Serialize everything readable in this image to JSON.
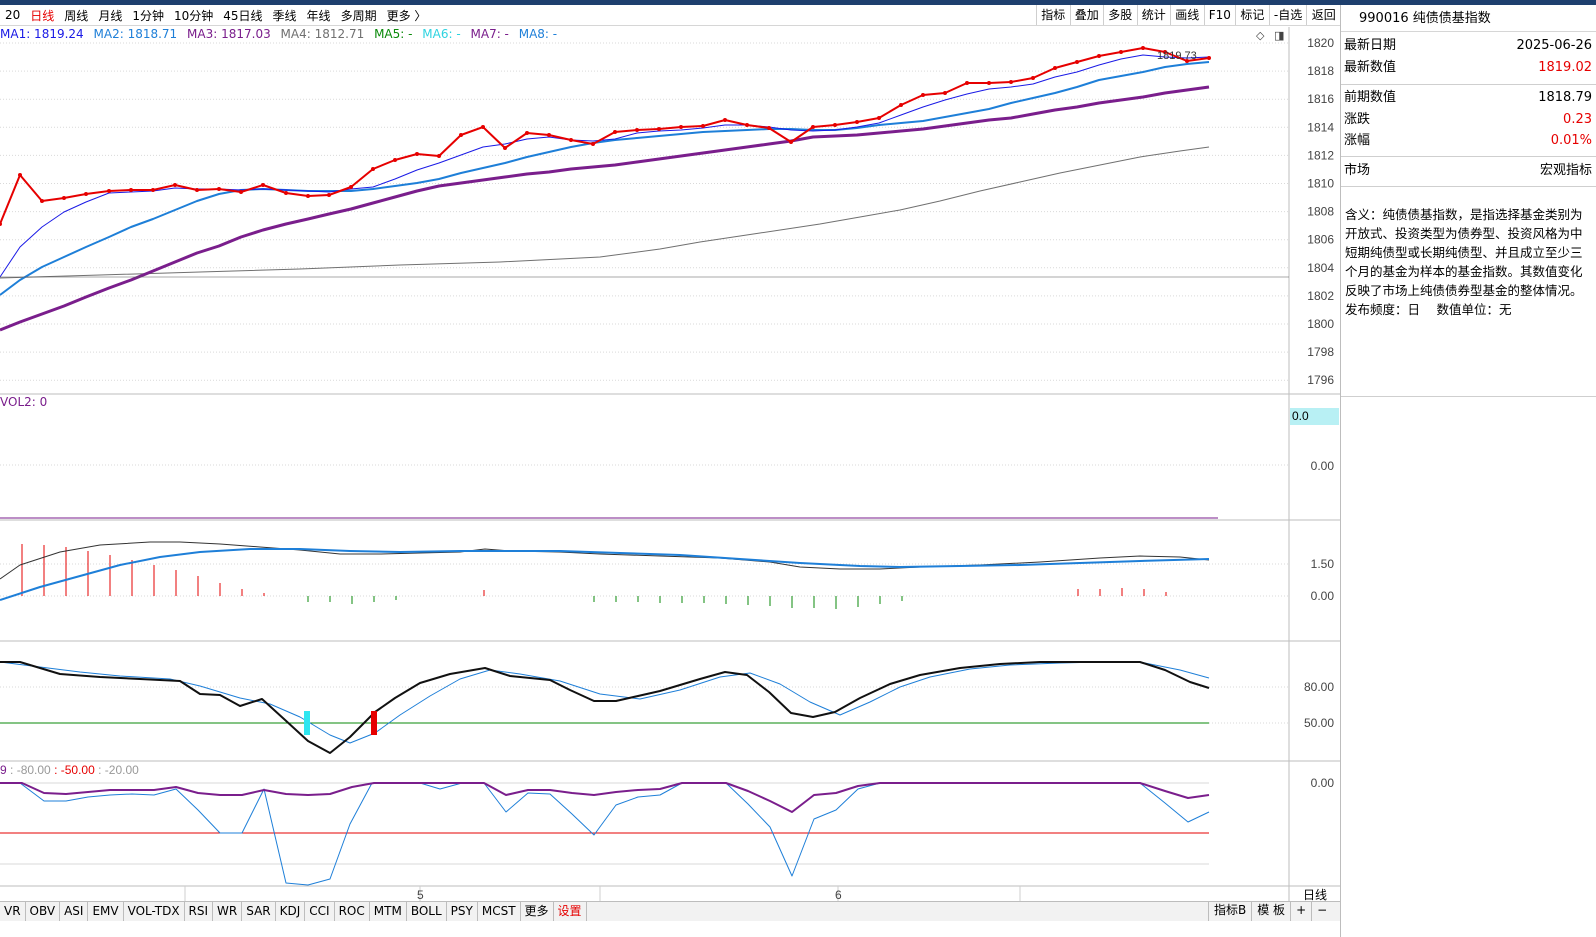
{
  "period_bar": {
    "items": [
      "20",
      "日线",
      "周线",
      "月线",
      "1分钟",
      "10分钟",
      "45日线",
      "季线",
      "年线",
      "多周期",
      "更多 〉"
    ],
    "active_index": 1
  },
  "toolbar": {
    "items": [
      "指标",
      "叠加",
      "多股",
      "统计",
      "画线",
      "F10",
      "标记",
      "-自选",
      "返回"
    ]
  },
  "ma_legend": [
    {
      "label": "MA1: 1819.24",
      "color": "#1a1ae6"
    },
    {
      "label": "MA2: 1818.71",
      "color": "#1e7fd8"
    },
    {
      "label": "MA3: 1817.03",
      "color": "#7a1e8c"
    },
    {
      "label": "MA4: 1812.71",
      "color": "#707070"
    },
    {
      "label": "MA5: -",
      "color": "#0a8a0a"
    },
    {
      "label": "MA6: -",
      "color": "#2ed3e0"
    },
    {
      "label": "MA7: -",
      "color": "#7a1e8c"
    },
    {
      "label": "MA8: -",
      "color": "#1e7fd8"
    }
  ],
  "price_axis": {
    "ticks": [
      "1820",
      "1818",
      "1816",
      "1814",
      "1812",
      "1810",
      "1808",
      "1806",
      "1804",
      "1802",
      "1800",
      "1798",
      "1796"
    ]
  },
  "price_marker": "1819.73",
  "vol_panel": {
    "label": "VOL2: 0",
    "value_box": "0.0",
    "tick": "0.00"
  },
  "macd_panel": {
    "ticks": [
      "1.50",
      "0.00"
    ]
  },
  "kdj_panel": {
    "ticks": [
      "80.00",
      "50.00"
    ]
  },
  "wr_panel": {
    "legend": [
      {
        "text": "9",
        "color": "#7a1e8c"
      },
      {
        "text": ": -80.00",
        "color": "#999999"
      },
      {
        "text": ": -50.00",
        "color": "#e60000"
      },
      {
        "text": ": -20.00",
        "color": "#999999"
      }
    ],
    "tick": "0.00"
  },
  "time_axis": {
    "labels": [
      "5",
      "6"
    ],
    "period": "日线"
  },
  "bottom_tabs": {
    "items": [
      "VR",
      "OBV",
      "ASI",
      "EMV",
      "VOL-TDX",
      "RSI",
      "WR",
      "SAR",
      "KDJ",
      "CCI",
      "ROC",
      "MTM",
      "BOLL",
      "PSY",
      "MCST",
      "更多",
      "设置"
    ],
    "active_index": 16,
    "right": [
      "指标B",
      "模 板",
      "+",
      "−"
    ]
  },
  "info": {
    "title": "990016 纯债债基指数",
    "rows": [
      {
        "k": "最新日期",
        "v": "2025-06-26",
        "red": false
      },
      {
        "k": "最新数值",
        "v": "1819.02",
        "red": true
      },
      {
        "k": "前期数值",
        "v": "1818.79",
        "red": false
      },
      {
        "k": "涨跌",
        "v": "0.23",
        "red": true
      },
      {
        "k": "涨幅",
        "v": "0.01%",
        "red": true
      },
      {
        "k": "市场",
        "v": "宏观指标",
        "red": false
      }
    ],
    "description": "含义：纯债债基指数，是指选择基金类别为开放式、投资类型为债券型、投资风格为中短期纯债型或长期纯债型、并且成立至少三个月的基金为样本的基金指数。其数值变化反映了市场上纯债债券型基金的整体情况。",
    "frequency": "发布频度：日　 数值单位：无"
  },
  "colors": {
    "up": "#e60000",
    "ma1": "#1a1ae6",
    "ma2": "#1e7fd8",
    "ma3": "#7a1e8c",
    "ma4": "#707070",
    "grid": "#d9d9d9"
  }
}
